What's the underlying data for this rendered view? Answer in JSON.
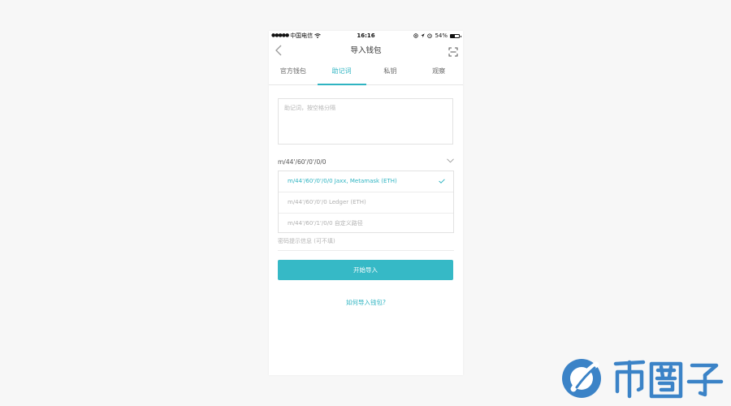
{
  "statusbar": {
    "carrier": "中国电信",
    "time": "16:16",
    "battery": "54%",
    "battery_level": 0.54
  },
  "nav": {
    "title": "导入钱包",
    "back_icon": "chevron-left-icon",
    "scan_icon": "scan-icon"
  },
  "tabs": [
    {
      "label": "官方钱包",
      "active": false
    },
    {
      "label": "助记词",
      "active": true
    },
    {
      "label": "私钥",
      "active": false
    },
    {
      "label": "观察",
      "active": false
    }
  ],
  "mnemonic": {
    "placeholder": "助记词，按空格分隔"
  },
  "path": {
    "current": "m/44'/60'/0'/0/0",
    "options": [
      {
        "label": "m/44'/60'/0'/0/0 Jaxx, Metamask (ETH)",
        "selected": true
      },
      {
        "label": "m/44'/60'/0'/0 Ledger (ETH)",
        "selected": false
      },
      {
        "label": "m/44'/60'/1'/0/0  自定义路径",
        "selected": false
      }
    ]
  },
  "password_hint": {
    "placeholder": "密码提示信息 (可不填)"
  },
  "start_button": {
    "label": "开始导入"
  },
  "help_link": {
    "label": "如何导入钱包?"
  },
  "watermark": {
    "text": "币圈子"
  },
  "colors": {
    "accent": "#2fb4c2",
    "button": "#36b9c6",
    "logo_blue": "#3b83c7"
  }
}
